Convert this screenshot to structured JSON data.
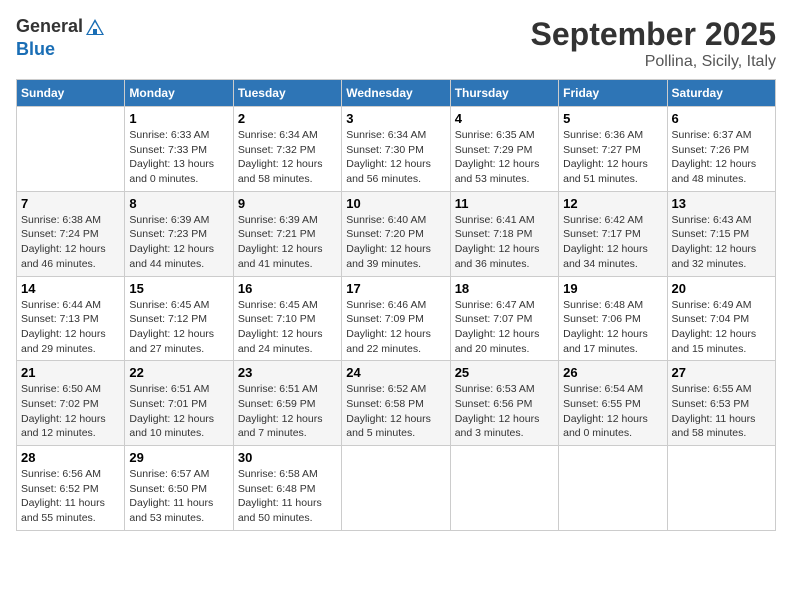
{
  "header": {
    "logo_general": "General",
    "logo_blue": "Blue",
    "month": "September 2025",
    "location": "Pollina, Sicily, Italy"
  },
  "days_of_week": [
    "Sunday",
    "Monday",
    "Tuesday",
    "Wednesday",
    "Thursday",
    "Friday",
    "Saturday"
  ],
  "weeks": [
    [
      {
        "day": "",
        "info": ""
      },
      {
        "day": "1",
        "info": "Sunrise: 6:33 AM\nSunset: 7:33 PM\nDaylight: 13 hours\nand 0 minutes."
      },
      {
        "day": "2",
        "info": "Sunrise: 6:34 AM\nSunset: 7:32 PM\nDaylight: 12 hours\nand 58 minutes."
      },
      {
        "day": "3",
        "info": "Sunrise: 6:34 AM\nSunset: 7:30 PM\nDaylight: 12 hours\nand 56 minutes."
      },
      {
        "day": "4",
        "info": "Sunrise: 6:35 AM\nSunset: 7:29 PM\nDaylight: 12 hours\nand 53 minutes."
      },
      {
        "day": "5",
        "info": "Sunrise: 6:36 AM\nSunset: 7:27 PM\nDaylight: 12 hours\nand 51 minutes."
      },
      {
        "day": "6",
        "info": "Sunrise: 6:37 AM\nSunset: 7:26 PM\nDaylight: 12 hours\nand 48 minutes."
      }
    ],
    [
      {
        "day": "7",
        "info": "Sunrise: 6:38 AM\nSunset: 7:24 PM\nDaylight: 12 hours\nand 46 minutes."
      },
      {
        "day": "8",
        "info": "Sunrise: 6:39 AM\nSunset: 7:23 PM\nDaylight: 12 hours\nand 44 minutes."
      },
      {
        "day": "9",
        "info": "Sunrise: 6:39 AM\nSunset: 7:21 PM\nDaylight: 12 hours\nand 41 minutes."
      },
      {
        "day": "10",
        "info": "Sunrise: 6:40 AM\nSunset: 7:20 PM\nDaylight: 12 hours\nand 39 minutes."
      },
      {
        "day": "11",
        "info": "Sunrise: 6:41 AM\nSunset: 7:18 PM\nDaylight: 12 hours\nand 36 minutes."
      },
      {
        "day": "12",
        "info": "Sunrise: 6:42 AM\nSunset: 7:17 PM\nDaylight: 12 hours\nand 34 minutes."
      },
      {
        "day": "13",
        "info": "Sunrise: 6:43 AM\nSunset: 7:15 PM\nDaylight: 12 hours\nand 32 minutes."
      }
    ],
    [
      {
        "day": "14",
        "info": "Sunrise: 6:44 AM\nSunset: 7:13 PM\nDaylight: 12 hours\nand 29 minutes."
      },
      {
        "day": "15",
        "info": "Sunrise: 6:45 AM\nSunset: 7:12 PM\nDaylight: 12 hours\nand 27 minutes."
      },
      {
        "day": "16",
        "info": "Sunrise: 6:45 AM\nSunset: 7:10 PM\nDaylight: 12 hours\nand 24 minutes."
      },
      {
        "day": "17",
        "info": "Sunrise: 6:46 AM\nSunset: 7:09 PM\nDaylight: 12 hours\nand 22 minutes."
      },
      {
        "day": "18",
        "info": "Sunrise: 6:47 AM\nSunset: 7:07 PM\nDaylight: 12 hours\nand 20 minutes."
      },
      {
        "day": "19",
        "info": "Sunrise: 6:48 AM\nSunset: 7:06 PM\nDaylight: 12 hours\nand 17 minutes."
      },
      {
        "day": "20",
        "info": "Sunrise: 6:49 AM\nSunset: 7:04 PM\nDaylight: 12 hours\nand 15 minutes."
      }
    ],
    [
      {
        "day": "21",
        "info": "Sunrise: 6:50 AM\nSunset: 7:02 PM\nDaylight: 12 hours\nand 12 minutes."
      },
      {
        "day": "22",
        "info": "Sunrise: 6:51 AM\nSunset: 7:01 PM\nDaylight: 12 hours\nand 10 minutes."
      },
      {
        "day": "23",
        "info": "Sunrise: 6:51 AM\nSunset: 6:59 PM\nDaylight: 12 hours\nand 7 minutes."
      },
      {
        "day": "24",
        "info": "Sunrise: 6:52 AM\nSunset: 6:58 PM\nDaylight: 12 hours\nand 5 minutes."
      },
      {
        "day": "25",
        "info": "Sunrise: 6:53 AM\nSunset: 6:56 PM\nDaylight: 12 hours\nand 3 minutes."
      },
      {
        "day": "26",
        "info": "Sunrise: 6:54 AM\nSunset: 6:55 PM\nDaylight: 12 hours\nand 0 minutes."
      },
      {
        "day": "27",
        "info": "Sunrise: 6:55 AM\nSunset: 6:53 PM\nDaylight: 11 hours\nand 58 minutes."
      }
    ],
    [
      {
        "day": "28",
        "info": "Sunrise: 6:56 AM\nSunset: 6:52 PM\nDaylight: 11 hours\nand 55 minutes."
      },
      {
        "day": "29",
        "info": "Sunrise: 6:57 AM\nSunset: 6:50 PM\nDaylight: 11 hours\nand 53 minutes."
      },
      {
        "day": "30",
        "info": "Sunrise: 6:58 AM\nSunset: 6:48 PM\nDaylight: 11 hours\nand 50 minutes."
      },
      {
        "day": "",
        "info": ""
      },
      {
        "day": "",
        "info": ""
      },
      {
        "day": "",
        "info": ""
      },
      {
        "day": "",
        "info": ""
      }
    ]
  ]
}
